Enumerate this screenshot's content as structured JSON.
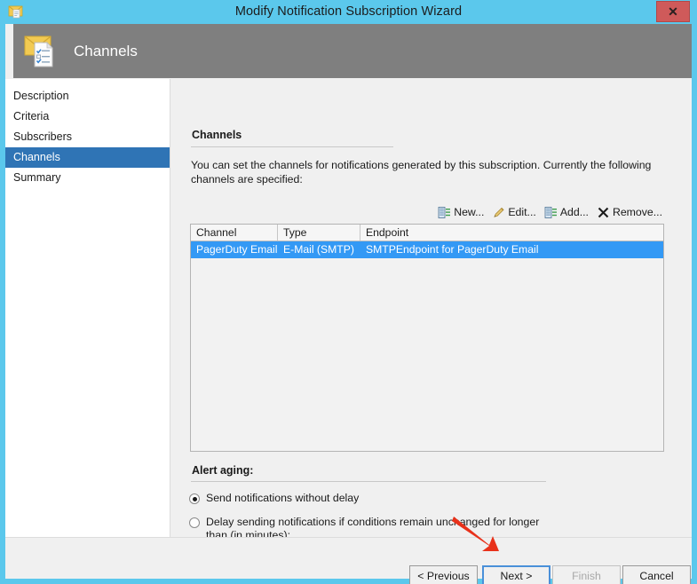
{
  "window": {
    "title": "Modify Notification Subscription Wizard",
    "icon": "envelope-document-icon",
    "close_label": "✕",
    "accent_titlebar_color": "#5bc8ec",
    "header_band_color": "#7f7f7f"
  },
  "header": {
    "title": "Channels",
    "icon": "envelope-checklist-icon"
  },
  "sidebar": {
    "items": [
      {
        "label": "Description",
        "selected": false
      },
      {
        "label": "Criteria",
        "selected": false
      },
      {
        "label": "Subscribers",
        "selected": false
      },
      {
        "label": "Channels",
        "selected": true
      },
      {
        "label": "Summary",
        "selected": false
      }
    ],
    "selected_color": "#2f74b5"
  },
  "main": {
    "section_title": "Channels",
    "intro_text": "You can set the channels for notifications generated by this subscription.  Currently the following channels are specified:",
    "toolbar": [
      {
        "label": "New...",
        "icon": "list-new-icon"
      },
      {
        "label": "Edit...",
        "icon": "pencil-icon"
      },
      {
        "label": "Add...",
        "icon": "list-add-icon"
      },
      {
        "label": "Remove...",
        "icon": "x-remove-icon"
      }
    ],
    "grid": {
      "columns": [
        "Channel",
        "Type",
        "Endpoint"
      ],
      "rows": [
        {
          "channel": "PagerDuty Email",
          "type": "E-Mail (SMTP)",
          "endpoint": "SMTPEndpoint for PagerDuty Email",
          "selected": true
        }
      ],
      "selection_color": "#3399f5"
    },
    "alert_aging": {
      "title": "Alert aging:",
      "options": [
        {
          "label": "Send notifications without delay",
          "checked": true
        },
        {
          "label": "Delay sending notifications if conditions remain unchanged for longer than (in minutes):",
          "checked": false
        }
      ],
      "delay_value": "",
      "delay_placeholder": ""
    }
  },
  "footer": {
    "previous_label": "< Previous",
    "next_label": "Next >",
    "finish_label": "Finish",
    "cancel_label": "Cancel"
  },
  "annotation": {
    "arrow": "red-arrow-pointing-to-next-button",
    "color": "#e8311a"
  }
}
